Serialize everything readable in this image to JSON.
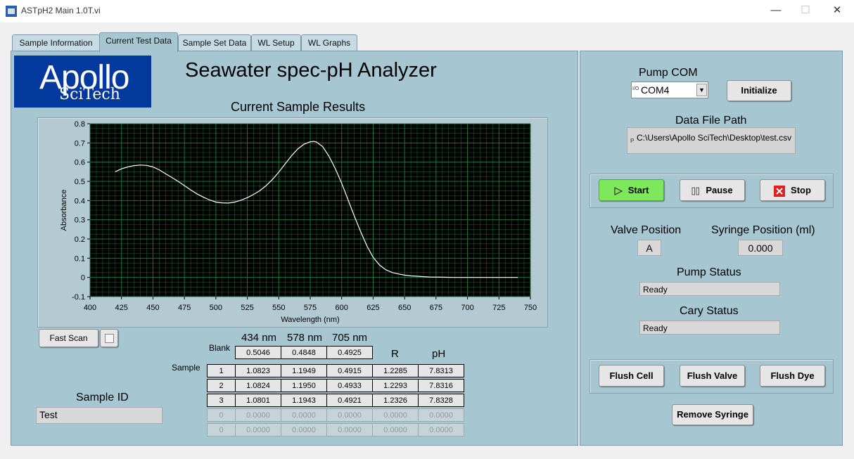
{
  "window": {
    "title": "ASTpH2 Main 1.0T.vi",
    "icon": "labview-vi-icon",
    "minimize_glyph": "—",
    "maximize_glyph": "☐",
    "close_glyph": "✕"
  },
  "tabs": [
    {
      "label": "Sample Information",
      "active": false
    },
    {
      "label": "Current Test Data",
      "active": true
    },
    {
      "label": "Sample Set Data",
      "active": false
    },
    {
      "label": "WL Setup",
      "active": false
    },
    {
      "label": "WL Graphs",
      "active": false
    }
  ],
  "logo": {
    "line1": "Apollo",
    "line2": "SciTech"
  },
  "heading": "Seawater spec-pH Analyzer",
  "chart_heading": "Current Sample Results",
  "chart_data": {
    "type": "line",
    "xlabel": "Wavelength (nm)",
    "ylabel": "Absorbance",
    "xlim": [
      400,
      750
    ],
    "ylim": [
      -0.1,
      0.8
    ],
    "x_ticks": [
      "400",
      "425",
      "450",
      "475",
      "500",
      "525",
      "550",
      "575",
      "600",
      "625",
      "650",
      "675",
      "700",
      "725",
      "750"
    ],
    "y_ticks": [
      "0.8",
      "0.7",
      "0.6",
      "0.5",
      "0.4",
      "0.3",
      "0.2",
      "0.1",
      "0",
      "-0.1"
    ],
    "grid": true,
    "background": "#000000",
    "grid_color": "#1f7a3a",
    "line_color": "#ffffff",
    "series": [
      {
        "x": [
          420,
          425,
          430,
          435,
          440,
          445,
          450,
          455,
          460,
          465,
          470,
          475,
          480,
          485,
          490,
          495,
          500,
          505,
          510,
          515,
          520,
          525,
          530,
          535,
          540,
          545,
          550,
          555,
          560,
          565,
          570,
          575,
          578,
          580,
          585,
          590,
          595,
          600,
          605,
          610,
          615,
          620,
          625,
          630,
          635,
          640,
          645,
          650,
          655,
          660,
          665,
          670,
          680,
          690,
          700,
          710,
          720,
          730,
          740
        ],
        "y": [
          0.55,
          0.565,
          0.575,
          0.582,
          0.585,
          0.583,
          0.575,
          0.56,
          0.54,
          0.52,
          0.5,
          0.478,
          0.455,
          0.435,
          0.418,
          0.403,
          0.392,
          0.388,
          0.387,
          0.392,
          0.402,
          0.415,
          0.432,
          0.452,
          0.478,
          0.51,
          0.548,
          0.59,
          0.632,
          0.668,
          0.693,
          0.706,
          0.708,
          0.705,
          0.68,
          0.63,
          0.565,
          0.49,
          0.405,
          0.32,
          0.24,
          0.165,
          0.105,
          0.065,
          0.04,
          0.026,
          0.018,
          0.012,
          0.008,
          0.006,
          0.004,
          0.002,
          0.001,
          0.0,
          0.0,
          0.0,
          0.0,
          0.0,
          0.0
        ]
      }
    ]
  },
  "buttons": {
    "fast_scan": "Fast Scan",
    "initialize": "Initialize",
    "start": "Start",
    "pause": "Pause",
    "stop": "Stop",
    "flush_cell": "Flush Cell",
    "flush_valve": "Flush Valve",
    "flush_dye": "Flush Dye",
    "remove_syringe": "Remove Syringe"
  },
  "results": {
    "col_headers": [
      "434 nm",
      "578 nm",
      "705 nm"
    ],
    "r_header": "R",
    "ph_header": "pH",
    "blank_label": "Blank",
    "sample_label": "Sample",
    "blank": [
      "0.5046",
      "0.4848",
      "0.4925"
    ],
    "samples": [
      {
        "idx": "1",
        "v434": "1.0823",
        "v578": "1.1949",
        "v705": "0.4915",
        "r": "1.2285",
        "ph": "7.8313",
        "active": true
      },
      {
        "idx": "2",
        "v434": "1.0824",
        "v578": "1.1950",
        "v705": "0.4933",
        "r": "1.2293",
        "ph": "7.8316",
        "active": true
      },
      {
        "idx": "3",
        "v434": "1.0801",
        "v578": "1.1943",
        "v705": "0.4921",
        "r": "1.2326",
        "ph": "7.8328",
        "active": true
      },
      {
        "idx": "0",
        "v434": "0.0000",
        "v578": "0.0000",
        "v705": "0.0000",
        "r": "0.0000",
        "ph": "0.0000",
        "active": false
      },
      {
        "idx": "0",
        "v434": "0.0000",
        "v578": "0.0000",
        "v705": "0.0000",
        "r": "0.0000",
        "ph": "0.0000",
        "active": false
      }
    ]
  },
  "sample_id": {
    "label": "Sample ID",
    "value": "Test"
  },
  "pump_com": {
    "label": "Pump COM",
    "value": "COM4",
    "io_glyph": "I/O",
    "dropdown_glyph": "▼"
  },
  "data_file": {
    "label": "Data File Path",
    "value": "C:\\Users\\Apollo SciTech\\Desktop\\test.csv",
    "path_glyph": "P"
  },
  "valve": {
    "label": "Valve Position",
    "value": "A"
  },
  "syringe": {
    "label": "Syringe Position (ml)",
    "value": "0.000"
  },
  "pump_status": {
    "label": "Pump Status",
    "value": "Ready"
  },
  "cary_status": {
    "label": "Cary Status",
    "value": "Ready"
  },
  "colors": {
    "panel": "#a6c6d2",
    "start_green": "#7ee85c",
    "stop_red": "#e02020",
    "logo_blue": "#03389c"
  }
}
